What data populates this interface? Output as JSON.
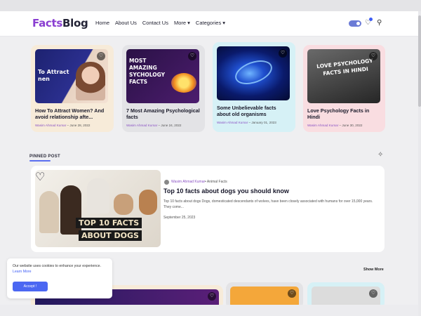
{
  "header": {
    "logo_part1": "Facts",
    "logo_part2": "Blog",
    "nav": [
      "Home",
      "About Us",
      "Contact Us",
      "More ▾",
      "Categories ▾"
    ]
  },
  "icons": {
    "heart": "heart-icon",
    "search": "search-icon",
    "theme_toggle": "toggle-switch",
    "sparkle": "sparkle-icon"
  },
  "colors": {
    "accent": "#5b6ff0",
    "brand": "#8a3fd1"
  },
  "cards": [
    {
      "title": "How To Attract Women? And avoid relationship afte...",
      "author": "Wasim Ahmad Kumar",
      "date": "June 28, 2022",
      "thumb_text": "To Attract nen",
      "bg": "#f7ebd9"
    },
    {
      "title": "7 Most Amazing Psychological facts",
      "author": "Wasim Ahmad Kumar",
      "date": "June 24, 2022",
      "thumb_text": "MOST AMAZING SYCHOLOGY FACTS",
      "bg": "#e3e3e6"
    },
    {
      "title": "Some Unbelievable facts about old organisms",
      "author": "Wasim Ahmad Kumar",
      "date": "January 01, 2023",
      "thumb_text": "",
      "bg": "#d6f1f6"
    },
    {
      "title": "Love Psychology Facts in Hindi",
      "author": "Wasim Ahmad Kumar",
      "date": "June 30, 2022",
      "thumb_text": "LOVE PSYCHOLOGY FACTS IN HINDI",
      "bg": "#f9dde1"
    }
  ],
  "pinned": {
    "label": "PINNED POST",
    "author": "Wasim Ahmad Kumar",
    "category": "• Animal Facts",
    "title": "Top 10 facts about dogs you should know",
    "excerpt": "Top 10 facts about dogs Dogs, domesticated descendants of wolves, have been closely associated with humans for over 15,000 years. They come...",
    "date": "September 25, 2023",
    "image_text_1": "TOP 10 FACTS",
    "image_text_2": "ABOUT DOGS"
  },
  "cookie": {
    "text": "Our website uses cookies to enhance your experience.",
    "link": "Learn More",
    "button": "Accept !"
  },
  "section": {
    "show_more": "Show More"
  }
}
